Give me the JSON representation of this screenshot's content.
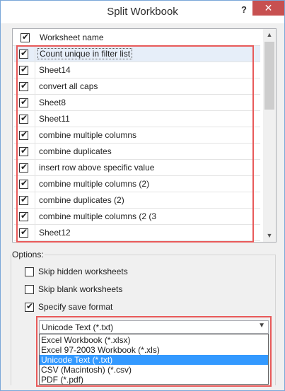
{
  "window": {
    "title": "Split Workbook",
    "help_label": "?",
    "close_label": "✕"
  },
  "list": {
    "header_label": "Worksheet name",
    "header_checked": true,
    "items": [
      {
        "label": "Count unique in filter list",
        "checked": true,
        "selected": true
      },
      {
        "label": "Sheet14",
        "checked": true
      },
      {
        "label": "convert all caps",
        "checked": true
      },
      {
        "label": "Sheet8",
        "checked": true
      },
      {
        "label": "Sheet11",
        "checked": true
      },
      {
        "label": "combine multiple columns",
        "checked": true
      },
      {
        "label": "combine duplicates",
        "checked": true
      },
      {
        "label": "insert row above specific value",
        "checked": true
      },
      {
        "label": "combine multiple columns (2)",
        "checked": true
      },
      {
        "label": "combine duplicates (2)",
        "checked": true
      },
      {
        "label": "combine multiple columns (2 (3",
        "checked": true
      },
      {
        "label": "Sheet12",
        "checked": true
      }
    ]
  },
  "options": {
    "group_label": "Options:",
    "skip_hidden": {
      "label": "Skip hidden worksheets",
      "checked": false
    },
    "skip_blank": {
      "label": "Skip blank worksheets",
      "checked": false
    },
    "specify_format": {
      "label": "Specify save format",
      "checked": true
    }
  },
  "format": {
    "selected_value": "Unicode Text (*.txt)",
    "options": [
      "Excel Workbook (*.xlsx)",
      "Excel 97-2003 Workbook (*.xls)",
      "Unicode Text (*.txt)",
      "CSV (Macintosh) (*.csv)",
      "PDF (*.pdf)"
    ],
    "highlighted_index": 2
  },
  "colors": {
    "highlight_box": "#e85a5a",
    "selection_blue": "#3399ff",
    "close_button": "#c75050"
  }
}
